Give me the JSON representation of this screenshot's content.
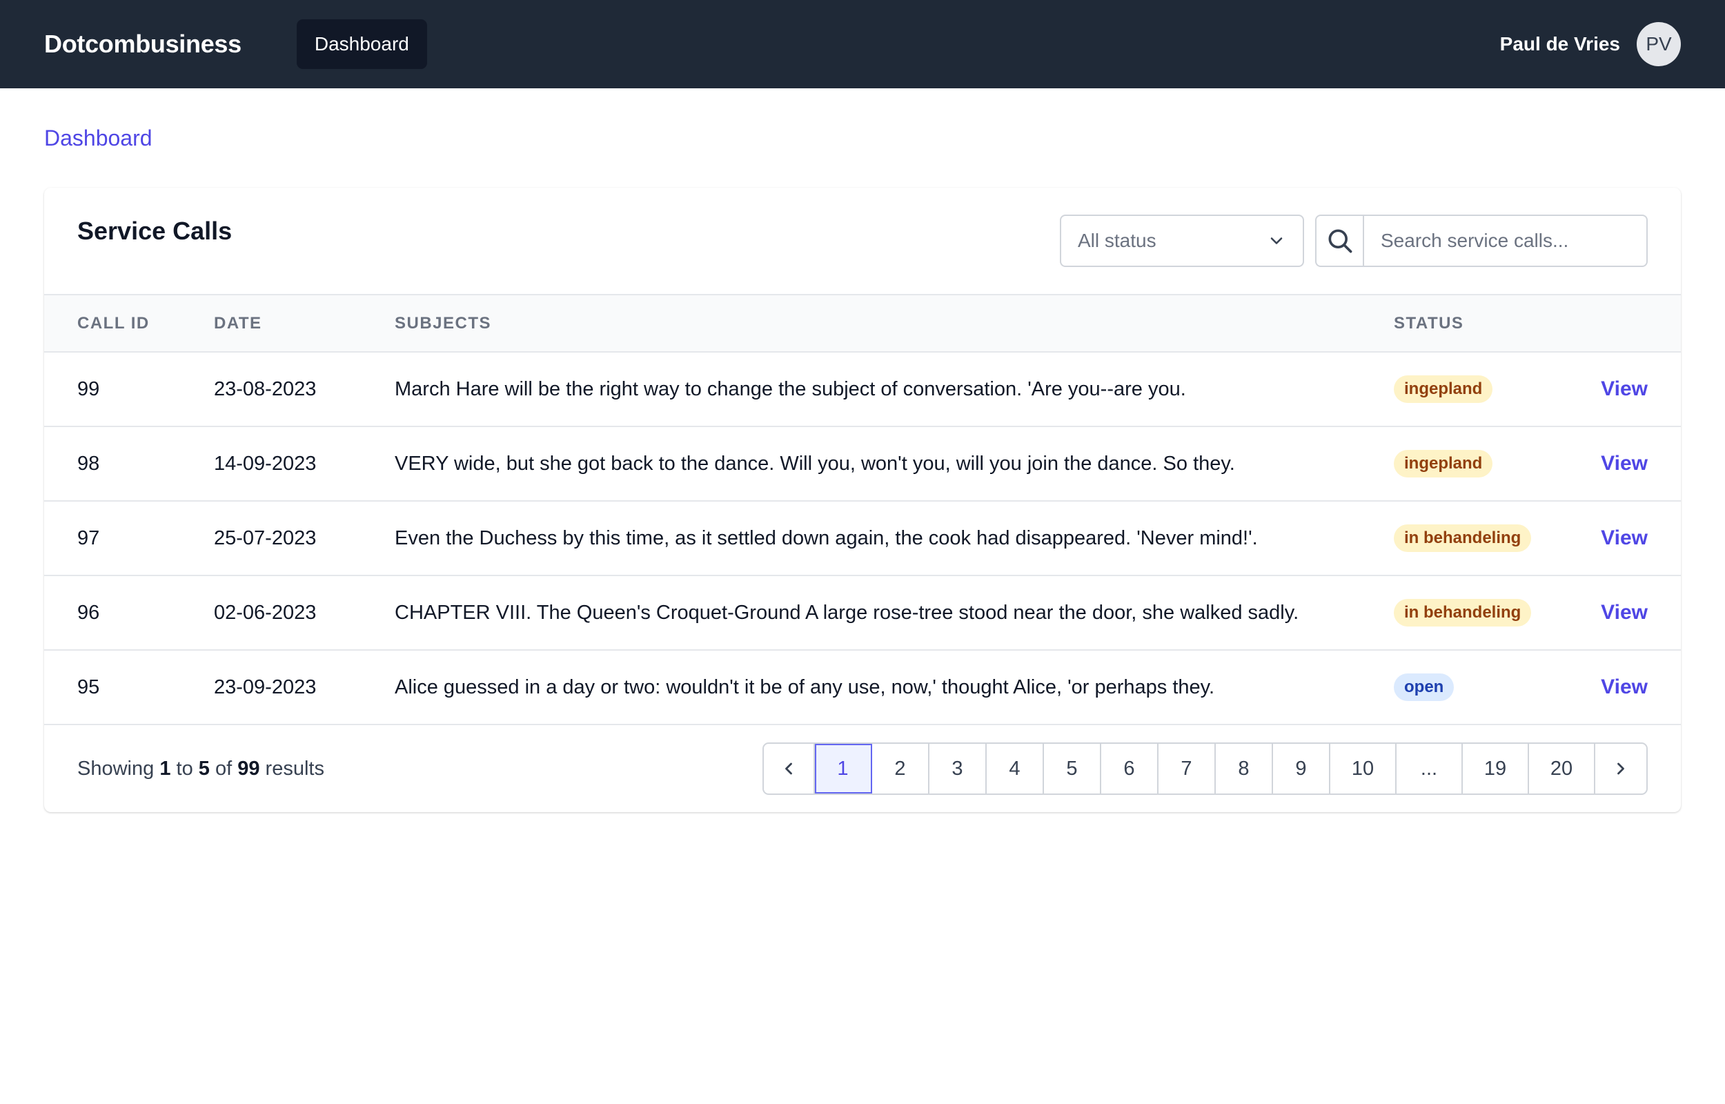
{
  "nav": {
    "brand": "Dotcombusiness",
    "link_dashboard": "Dashboard",
    "user_name": "Paul de Vries",
    "avatar_initials": "PV"
  },
  "breadcrumb": "Dashboard",
  "card": {
    "title": "Service Calls",
    "status_filter_value": "All status",
    "search_placeholder": "Search service calls..."
  },
  "table": {
    "headers": [
      "CALL ID",
      "DATE",
      "SUBJECTS",
      "STATUS"
    ],
    "rows": [
      {
        "id": "99",
        "date": "23-08-2023",
        "subject": "March Hare will be the right way to change the subject of conversation. 'Are you--are you.",
        "status": "ingepland",
        "action": "View"
      },
      {
        "id": "98",
        "date": "14-09-2023",
        "subject": "VERY wide, but she got back to the dance. Will you, won't you, will you join the dance. So they.",
        "status": "ingepland",
        "action": "View"
      },
      {
        "id": "97",
        "date": "25-07-2023",
        "subject": "Even the Duchess by this time, as it settled down again, the cook had disappeared. 'Never mind!'.",
        "status": "in behandeling",
        "action": "View"
      },
      {
        "id": "96",
        "date": "02-06-2023",
        "subject": "CHAPTER VIII. The Queen's Croquet-Ground A large rose-tree stood near the door, she walked sadly.",
        "status": "in behandeling",
        "action": "View"
      },
      {
        "id": "95",
        "date": "23-09-2023",
        "subject": "Alice guessed in a day or two: wouldn't it be of any use, now,' thought Alice, 'or perhaps they.",
        "status": "open",
        "action": "View"
      }
    ]
  },
  "footer": {
    "showing_prefix": "Showing",
    "from": "1",
    "to_word": "to",
    "to": "5",
    "of_word": "of",
    "total": "99",
    "results_word": "results"
  },
  "pagination": {
    "pages": [
      "1",
      "2",
      "3",
      "4",
      "5",
      "6",
      "7",
      "8",
      "9",
      "10",
      "...",
      "19",
      "20"
    ],
    "current": "1"
  },
  "colors": {
    "navbar": "#1f2937",
    "accent": "#4f46e5",
    "badge_warning_bg": "#fef3c7",
    "badge_warning_text": "#92400e",
    "badge_open_bg": "#dbeafe",
    "badge_open_text": "#1e40af"
  }
}
